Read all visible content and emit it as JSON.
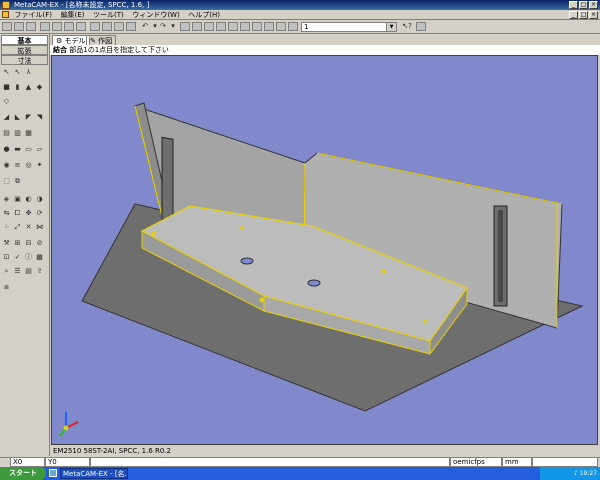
{
  "window": {
    "title": "MetaCAM-EX - [名称未設定, SPCC, 1.6, ]",
    "buttons": [
      "_",
      "□",
      "×"
    ]
  },
  "menu": {
    "items": [
      "ファイル(F)",
      "編集(E)",
      "ツール(T)",
      "ウィンドウ(W)",
      "ヘルプ(H)"
    ],
    "doc_buttons": [
      "_",
      "□",
      "×"
    ]
  },
  "toolbar": {
    "layer_value": "1"
  },
  "left_panel": {
    "tabs": [
      "基本",
      "拡張",
      "寸法"
    ]
  },
  "doc_tabs": [
    "モデル",
    "作図"
  ],
  "prompt": {
    "label": "結合",
    "text": "部品1の1点目を指定して下さい"
  },
  "info": {
    "part_text": "EM2510 58ST-2AI, SPCC, 1.6 R0.2"
  },
  "status": {
    "x": "X0",
    "y": "Y0",
    "mode": "oemicfps",
    "unit": "mm"
  },
  "taskbar": {
    "start_label": "スタート",
    "app_label": "MetaCAM-EX - [名...",
    "time": "19:27"
  },
  "colors": {
    "viewport_bg": "#8288cc",
    "edge_highlight": "#e6d200",
    "title_bar": "#0a246a"
  }
}
